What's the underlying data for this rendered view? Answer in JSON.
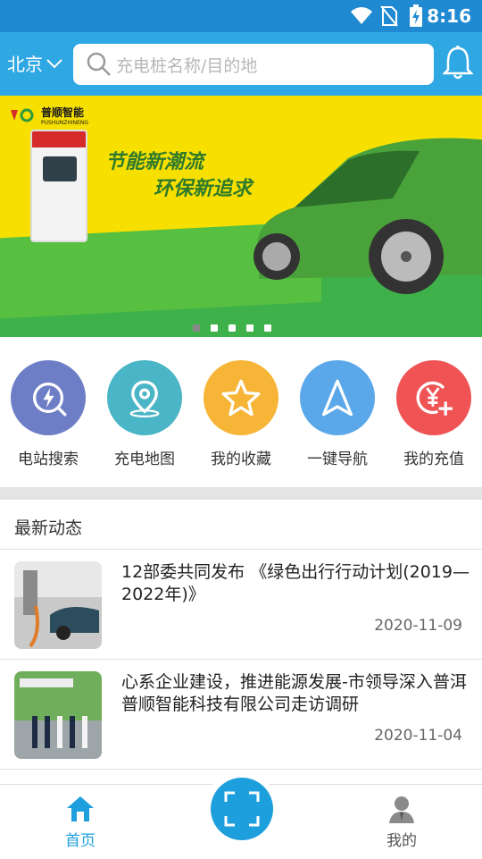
{
  "status_bar": {
    "time": "8:16"
  },
  "header": {
    "city": "北京",
    "search_placeholder": "充电桩名称/目的地"
  },
  "banner": {
    "brand_name": "普顺智能",
    "brand_sub": "PUSHUNZHINENG",
    "slogan_line1": "节能新潮流",
    "slogan_line2": "环保新追求",
    "slide_count": 5,
    "active_slide": 1
  },
  "menu": {
    "items": [
      {
        "label": "电站搜索",
        "icon": "lightning-search-icon",
        "color": "#6e7ec6"
      },
      {
        "label": "充电地图",
        "icon": "map-pin-icon",
        "color": "#4ab5c6"
      },
      {
        "label": "我的收藏",
        "icon": "star-icon",
        "color": "#f6b537"
      },
      {
        "label": "一键导航",
        "icon": "navigation-arrow-icon",
        "color": "#5aa8e9"
      },
      {
        "label": "我的充值",
        "icon": "yen-plus-icon",
        "color": "#ef5354"
      }
    ]
  },
  "news": {
    "section_title": "最新动态",
    "items": [
      {
        "title": "12部委共同发布 《绿色出行行动计划(2019—2022年)》",
        "date": "2020-11-09"
      },
      {
        "title": "心系企业建设，推进能源发展-市领导深入普洱普顺智能科技有限公司走访调研",
        "date": "2020-11-04"
      }
    ]
  },
  "tabbar": {
    "home_label": "首页",
    "mine_label": "我的",
    "active_color": "#1e9fdd"
  }
}
